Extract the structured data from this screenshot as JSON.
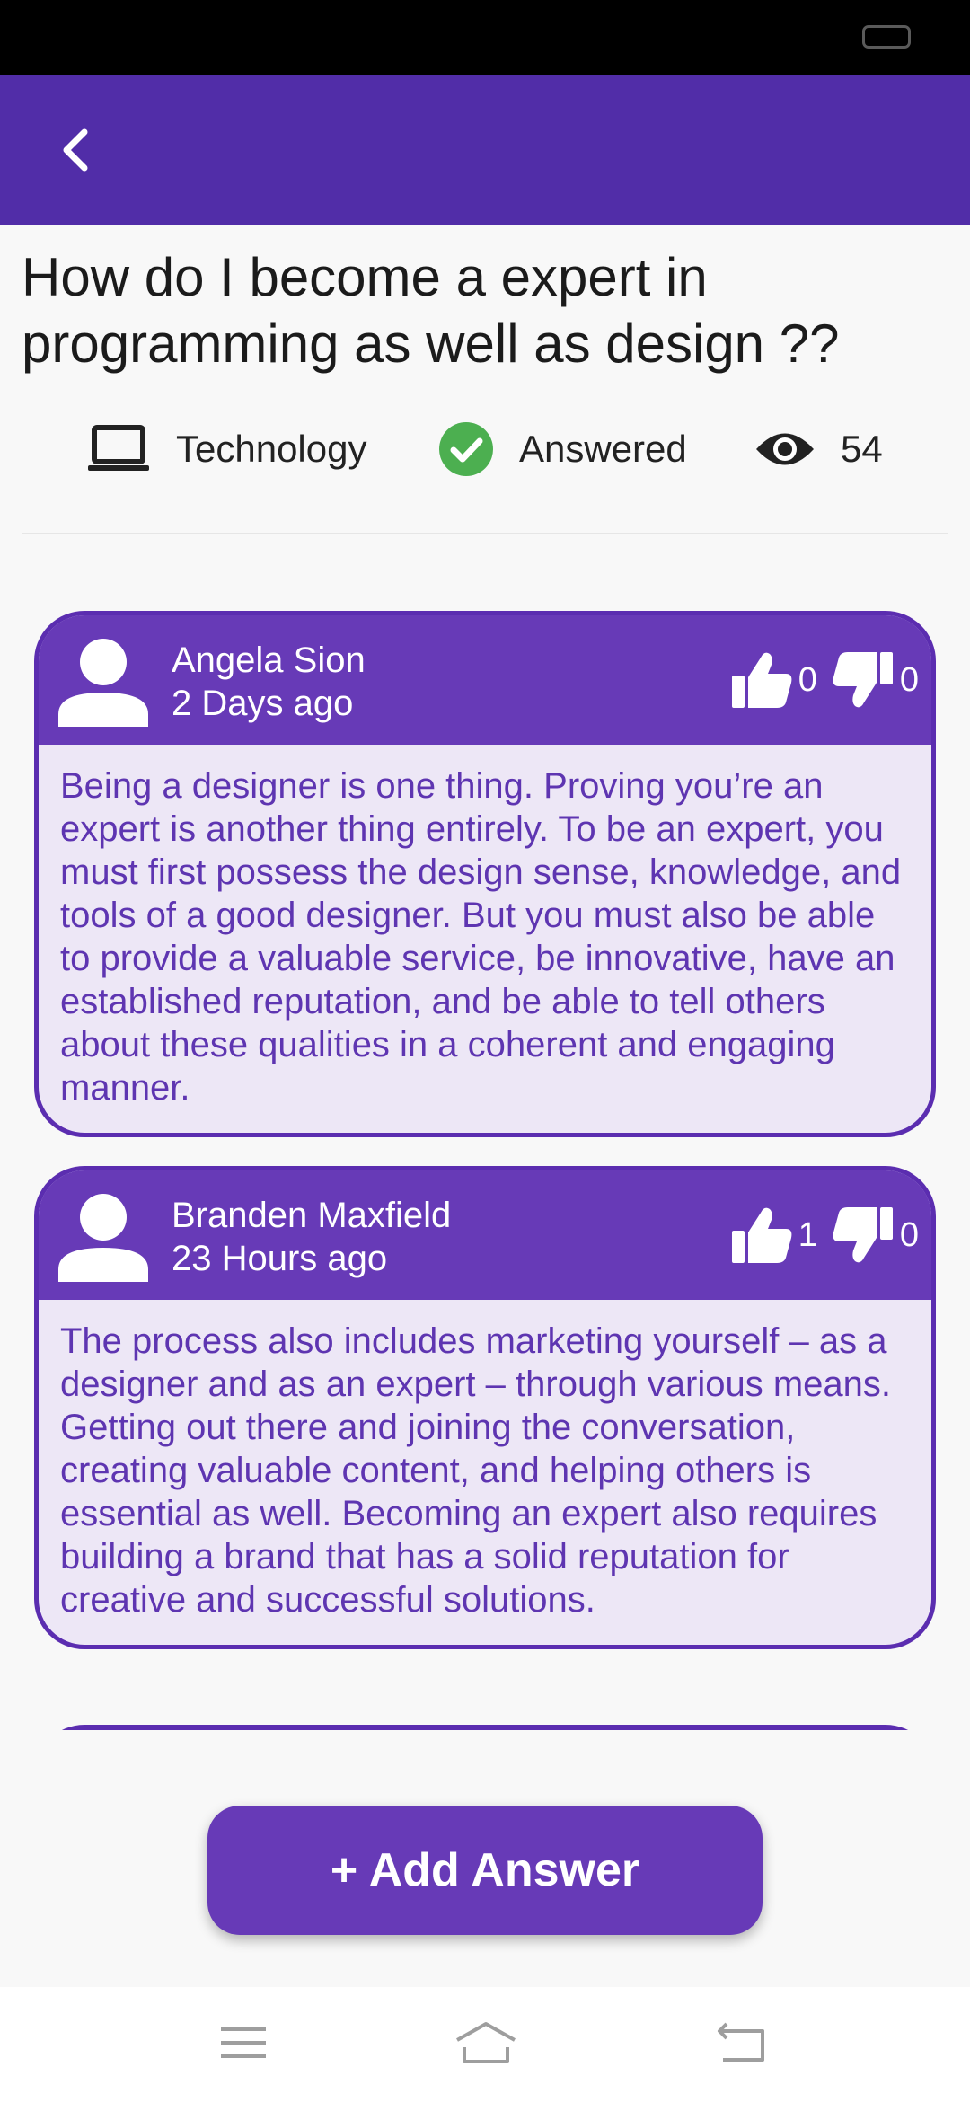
{
  "question": {
    "title": "How do I become a expert in programming as well as design ??",
    "category": "Technology",
    "status": "Answered",
    "views": "54"
  },
  "answers": [
    {
      "author": "Angela Sion",
      "time": "2 Days ago",
      "likes": "0",
      "dislikes": "0",
      "body": "Being a designer is one thing. Proving you’re an expert is another thing entirely. To be an expert, you must first possess the design sense, knowledge, and tools of a good designer. But you must also be able to provide a valuable service, be innovative, have an established reputation, and be able to tell others about these qualities in a coherent and engaging manner."
    },
    {
      "author": "Branden Maxfield",
      "time": "23 Hours ago",
      "likes": "1",
      "dislikes": "0",
      "body": "The process also includes marketing yourself – as a designer and as an expert – through various means. Getting out there and joining the conversation, creating valuable content, and helping others is essential as well. Becoming an expert also requires building a brand that has a solid reputation for creative and successful solutions."
    }
  ],
  "actions": {
    "add_answer_label": "+ Add Answer"
  },
  "icons": {
    "back": "chevron-left-icon",
    "category": "laptop-icon",
    "status": "check-circle-icon",
    "views": "eye-icon",
    "avatar": "person-icon",
    "like": "thumbs-up-icon",
    "dislike": "thumbs-down-icon",
    "nav_menu": "menu-icon",
    "nav_home": "home-icon",
    "nav_back": "return-icon"
  },
  "colors": {
    "primary": "#512da8",
    "card_header": "#673ab7",
    "card_body": "#ede7f6",
    "answer_text": "#5e35b1",
    "answered_green": "#4caf50"
  }
}
